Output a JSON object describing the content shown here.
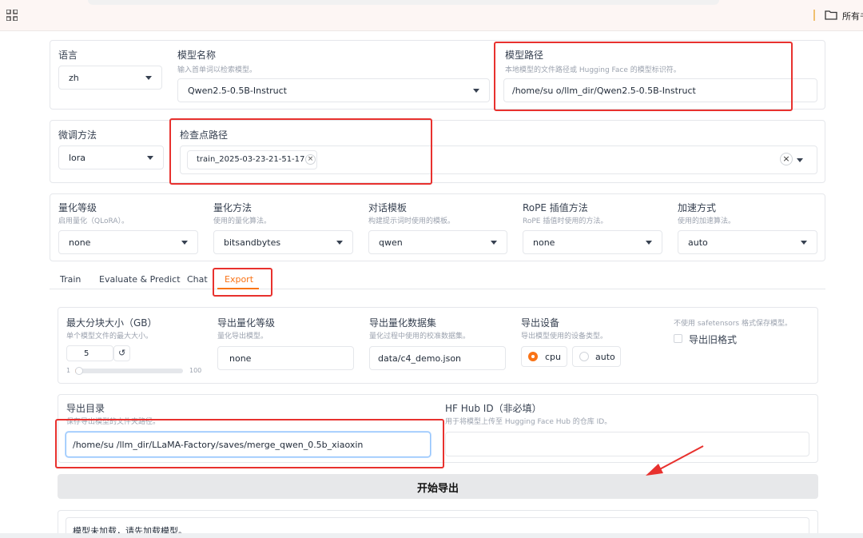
{
  "browser": {
    "bookmark_label": "所有书"
  },
  "model_card": {
    "language": {
      "label": "语言",
      "value": "zh"
    },
    "model_name": {
      "label": "模型名称",
      "info": "输入首单词以检索模型。",
      "value": "Qwen2.5-0.5B-Instruct"
    },
    "model_path": {
      "label": "模型路径",
      "info": "本地模型的文件路径或 Hugging Face 的模型标识符。",
      "value": "/home/su    o/llm_dir/Qwen2.5-0.5B-Instruct"
    }
  },
  "finetune_card": {
    "method": {
      "label": "微调方法",
      "value": "lora"
    },
    "checkpoint": {
      "label": "检查点路径",
      "chip": "train_2025-03-23-21-51-17",
      "chip_close": "×",
      "clear": "×"
    }
  },
  "quant_card": {
    "quant_level": {
      "label": "量化等级",
      "info": "启用量化（QLoRA）。",
      "value": "none"
    },
    "quant_method": {
      "label": "量化方法",
      "info": "使用的量化算法。",
      "value": "bitsandbytes"
    },
    "template": {
      "label": "对话模板",
      "info": "构建提示词时使用的模板。",
      "value": "qwen"
    },
    "rope": {
      "label": "RoPE 插值方法",
      "info": "RoPE 插值时使用的方法。",
      "value": "none"
    },
    "accel": {
      "label": "加速方式",
      "info": "使用的加速算法。",
      "value": "auto"
    }
  },
  "tabs": [
    "Train",
    "Evaluate & Predict",
    "Chat",
    "Export"
  ],
  "active_tab": "Export",
  "export": {
    "shard": {
      "label": "最大分块大小（GB）",
      "info": "单个模型文件的最大大小。",
      "value": "5",
      "reset_icon": "↺",
      "min": "1",
      "max": "100",
      "fraction": 0.04
    },
    "quant_bit": {
      "label": "导出量化等级",
      "info": "量化导出模型。",
      "value": "none"
    },
    "dataset": {
      "label": "导出量化数据集",
      "info": "量化过程中使用的校准数据集。",
      "value": "data/c4_demo.json"
    },
    "device": {
      "label": "导出设备",
      "info": "导出模型使用的设备类型。",
      "options": [
        "cpu",
        "auto"
      ],
      "selected": "cpu"
    },
    "legacy": {
      "info": "不使用 safetensors 格式保存模型。",
      "label": "导出旧格式",
      "checked": false
    },
    "dir": {
      "label": "导出目录",
      "info": "保存导出模型的文件夹路径。",
      "value": "/home/su    /llm_dir/LLaMA-Factory/saves/merge_qwen_0.5b_xiaoxin"
    },
    "hub": {
      "label": "HF Hub ID（非必填）",
      "info": "用于将模型上传至 Hugging Face Hub 的仓库 ID。",
      "value": ""
    },
    "start_button": "开始导出",
    "output": "模型未加载，请先加载模型。"
  },
  "colors": {
    "accent": "#f97316",
    "annotation": "#e8312e"
  }
}
